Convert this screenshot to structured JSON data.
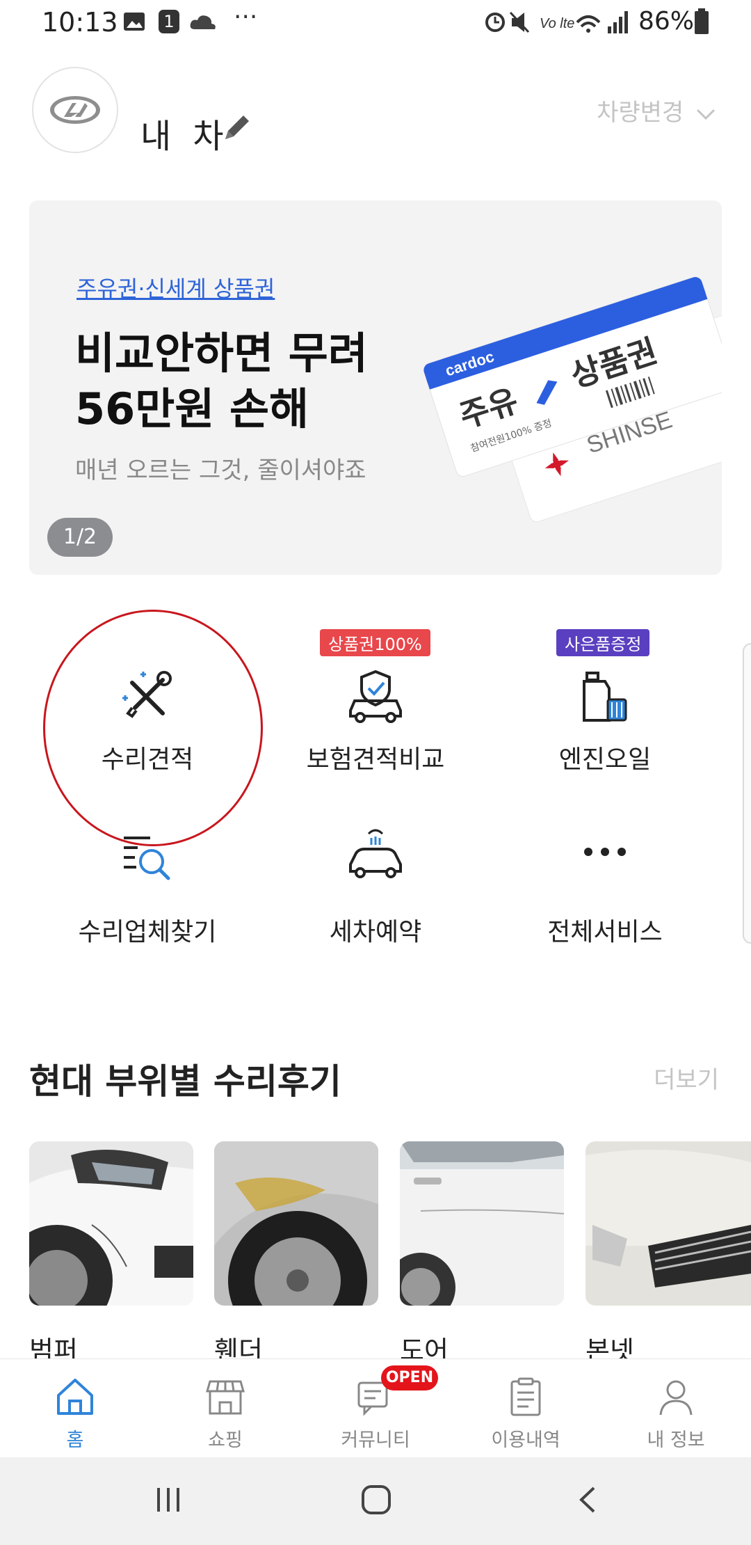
{
  "status_bar": {
    "time": "10:13",
    "battery": "86%",
    "notification_count": "1"
  },
  "header": {
    "title": "내 차",
    "change_vehicle": "차량변경"
  },
  "banner": {
    "tag": "주유권·신세계 상품권",
    "headline": "비교안하면 무려\n56만원 손해",
    "subtitle": "매년 오르는 그것, 줄이셔야죠",
    "counter": "1/2",
    "ticket": {
      "brand": "cardoc",
      "fuel": "주유",
      "voucher": "상품권",
      "note": "참여전원100% 증정",
      "store": "SHINSE"
    }
  },
  "services": [
    {
      "label": "수리견적",
      "badge": "",
      "icon": "repair-tools-icon"
    },
    {
      "label": "보험견적비교",
      "badge": "상품권100%",
      "badge_color": "#e8474b",
      "icon": "insurance-car-icon"
    },
    {
      "label": "엔진오일",
      "badge": "사은품증정",
      "badge_color": "#5a3fc0",
      "icon": "engine-oil-icon"
    },
    {
      "label": "수리업체찾기",
      "badge": "",
      "icon": "search-list-icon"
    },
    {
      "label": "세차예약",
      "badge": "",
      "icon": "car-wash-icon"
    },
    {
      "label": "전체서비스",
      "badge": "",
      "icon": "more-dots-icon"
    }
  ],
  "reviews": {
    "title": "현대 부위별 수리후기",
    "more": "더보기",
    "items": [
      {
        "part": "범퍼"
      },
      {
        "part": "휀더"
      },
      {
        "part": "도어"
      },
      {
        "part": "본넷"
      }
    ]
  },
  "tabbar": {
    "items": [
      {
        "label": "홈",
        "active": true
      },
      {
        "label": "쇼핑"
      },
      {
        "label": "커뮤니티",
        "badge": "OPEN"
      },
      {
        "label": "이용내역"
      },
      {
        "label": "내 정보"
      }
    ]
  },
  "colors": {
    "accent": "#2f84d9",
    "badge_red": "#e3151b",
    "highlight_circle": "#c8161d"
  }
}
